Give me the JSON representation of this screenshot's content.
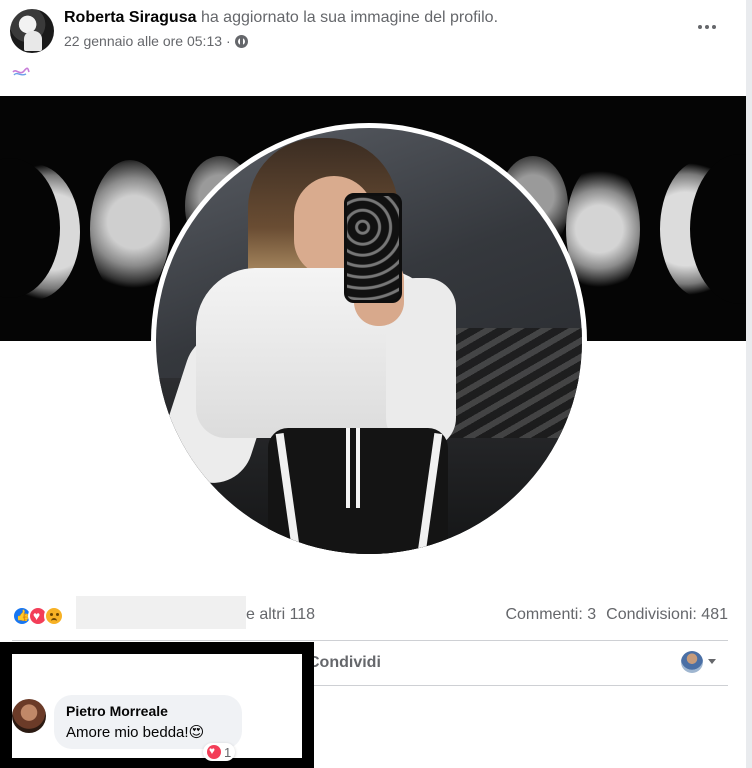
{
  "post": {
    "author": "Roberta Siragusa",
    "action_text": "ha aggiornato la sua immagine del profilo.",
    "timestamp": "22 gennaio alle ore 05:13",
    "separator": "·",
    "privacy_icon": "globe-icon",
    "menu_icon": "more-options-icon"
  },
  "reactions": {
    "icons": [
      "like-icon",
      "love-icon",
      "sad-icon"
    ],
    "others_text": "e altri 118",
    "comments_text": "Commenti: 3",
    "shares_text": "Condivisioni: 481"
  },
  "actions": {
    "share_label": "Condividi"
  },
  "comment": {
    "author": "Pietro Morreale",
    "text": "Amore mio bedda!😍",
    "reaction_count": "1"
  },
  "colors": {
    "secondary_text": "#65676b",
    "like": "#1877f2",
    "love": "#f33e58",
    "sad": "#f7b125",
    "divider": "#ced0d4"
  }
}
